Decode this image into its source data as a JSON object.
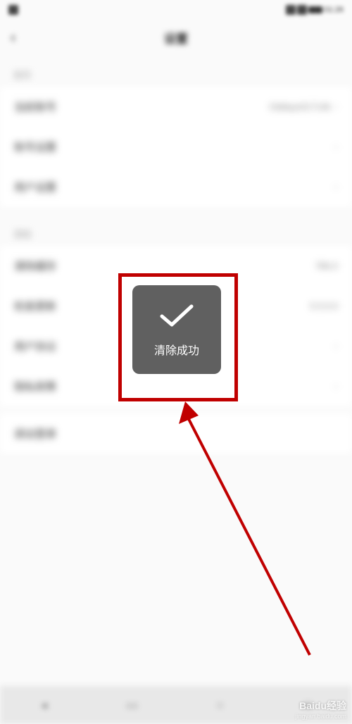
{
  "status": {
    "time": "01:26"
  },
  "header": {
    "back": "‹",
    "title": "设置"
  },
  "section1": {
    "label": "账号",
    "items": [
      {
        "label": "当前账号",
        "value": "Oddays01714k",
        "chevron": "›"
      },
      {
        "label": "账号设置",
        "value": "",
        "chevron": "›"
      },
      {
        "label": "用户设置",
        "value": "",
        "chevron": "›"
      }
    ]
  },
  "section2": {
    "label": "其他",
    "items": [
      {
        "label": "清除缓存",
        "value": "786.0",
        "chevron": ""
      },
      {
        "label": "检查更新",
        "value": "5.5.0.0",
        "chevron": ""
      },
      {
        "label": "用户协议",
        "value": "",
        "chevron": "›"
      },
      {
        "label": "隐私政策",
        "value": "",
        "chevron": "›"
      }
    ]
  },
  "logout": {
    "label": "退出登录"
  },
  "toast": {
    "text": "清除成功"
  },
  "watermark": {
    "main": "Baidu经验",
    "sub": "jingyan.baidu.com"
  }
}
